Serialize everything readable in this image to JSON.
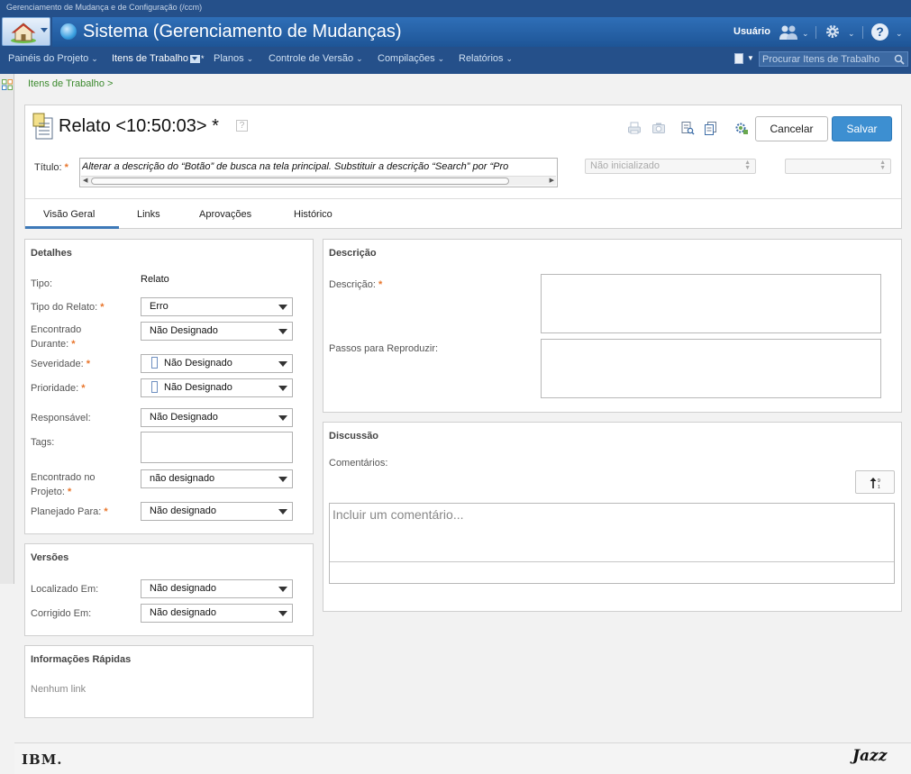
{
  "window": {
    "title": "Gerenciamento de Mudança e de Configuração (/ccm)"
  },
  "header": {
    "app_title": "Sistema (Gerenciamento de Mudanças)",
    "user_label": "Usuário"
  },
  "nav": {
    "items": [
      {
        "label": "Painéis do Projeto",
        "chevron": "⌄"
      },
      {
        "label": "Itens de Trabalho",
        "chevron": "*"
      },
      {
        "label": "Planos",
        "chevron": "⌄"
      },
      {
        "label": "Controle de Versão",
        "chevron": "⌄"
      },
      {
        "label": "Compilações",
        "chevron": "⌄"
      },
      {
        "label": "Relatórios",
        "chevron": "⌄"
      }
    ],
    "search_placeholder": "Procurar Itens de Trabalho"
  },
  "breadcrumb": "Itens de Trabalho >",
  "work_item": {
    "title": "Relato <10:50:03> *",
    "help": "?",
    "title_label": "Título:",
    "title_value": "Alterar a descrição do “Botão” de busca na tela principal. Substituir a descrição “Search” por “Pro",
    "state": "Não inicializado",
    "resolution": "",
    "buttons": {
      "cancel": "Cancelar",
      "save": "Salvar"
    }
  },
  "tabs": [
    {
      "label": "Visão Geral",
      "active": true
    },
    {
      "label": "Links"
    },
    {
      "label": "Aprovações"
    },
    {
      "label": "Histórico"
    }
  ],
  "details": {
    "title": "Detalhes",
    "type_label": "Tipo:",
    "type_value": "Relato",
    "fields": [
      {
        "label": "Tipo do Relato:",
        "value": "Erro"
      },
      {
        "label": "Encontrado Durante:",
        "value": "Não Designado"
      },
      {
        "label": "Severidade:",
        "value": "Não Designado"
      },
      {
        "label": "Prioridade:",
        "value": "Não Designado"
      },
      {
        "label": "Responsável:",
        "value": "Não Designado"
      },
      {
        "label": "Tags:",
        "value": ""
      },
      {
        "label": "Encontrado no Projeto:",
        "value": "não designado"
      },
      {
        "label": "Planejado Para:",
        "value": "Não designado"
      }
    ]
  },
  "versions": {
    "title": "Versões",
    "fields": [
      {
        "label": "Localizado Em:",
        "value": "Não designado"
      },
      {
        "label": "Corrigido Em:",
        "value": "Não designado"
      }
    ]
  },
  "quick_info": {
    "title": "Informações Rápidas",
    "empty": "Nenhum link"
  },
  "description": {
    "title": "Descrição",
    "desc_label": "Descrição:",
    "steps_label": "Passos para Reproduzir:"
  },
  "discussion": {
    "title": "Discussão",
    "comments_label": "Comentários:",
    "comment_placeholder": "Incluir um comentário..."
  },
  "footer": {
    "ibm": "IBM.",
    "jazz": "Jazz"
  },
  "colors": {
    "banner": "#25508a",
    "accent": "#3d8fd1",
    "required": "#e8752b",
    "breadcrumb": "#3c8a2e"
  }
}
